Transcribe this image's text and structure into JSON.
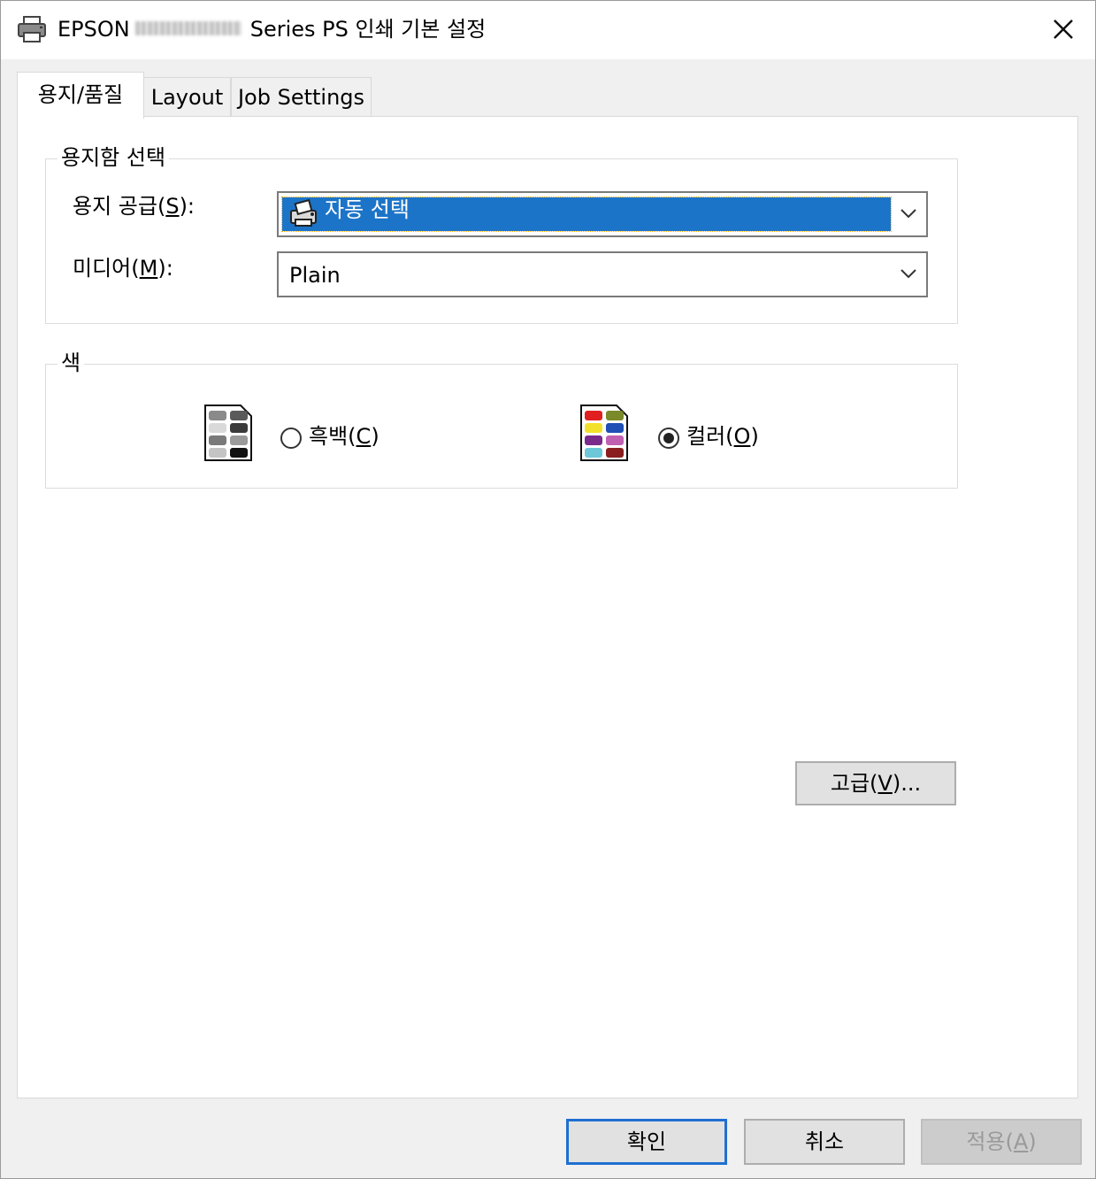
{
  "window": {
    "title_prefix": "EPSON",
    "title_suffix": "Series PS 인쇄 기본 설정",
    "printer_icon": "printer-icon",
    "close_icon": "close-icon"
  },
  "tabs": [
    {
      "label": "용지/품질",
      "active": true
    },
    {
      "label": "Layout",
      "active": false
    },
    {
      "label": "Job Settings",
      "active": false
    }
  ],
  "tray_group": {
    "legend": "용지함 선택",
    "source_label": "용지 공급",
    "source_key": "S",
    "source_value": "자동 선택",
    "source_icon": "auto-select-printer-icon",
    "media_label": "미디어",
    "media_key": "M",
    "media_value": "Plain"
  },
  "color_group": {
    "legend": "색",
    "mono_label": "흑백",
    "mono_key": "C",
    "mono_selected": false,
    "mono_icon": "grayscale-page-icon",
    "color_label": "컬러",
    "color_key": "O",
    "color_selected": true,
    "color_icon": "color-page-icon"
  },
  "advanced_button": {
    "label": "고급",
    "key": "V",
    "suffix": "..."
  },
  "footer": {
    "ok": "확인",
    "cancel": "취소",
    "apply": "적용",
    "apply_key": "A"
  }
}
